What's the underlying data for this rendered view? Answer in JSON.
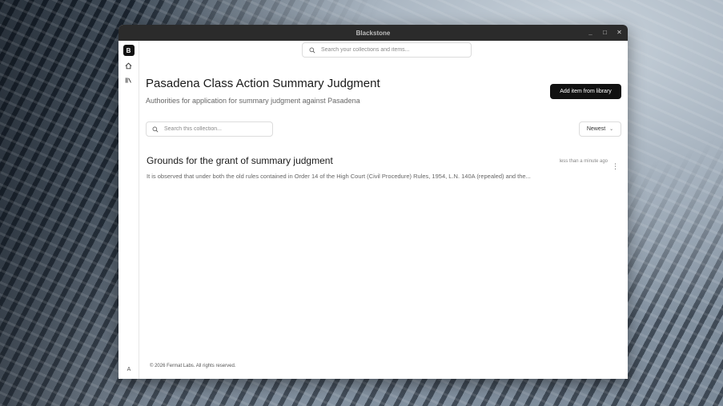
{
  "window": {
    "title": "Blackstone",
    "controls": {
      "minimize": "_",
      "maximize": "□",
      "close": "✕"
    }
  },
  "sidebar": {
    "logo": "B",
    "items": [
      {
        "icon": "home-icon"
      },
      {
        "icon": "library-icon"
      }
    ],
    "avatar": "A"
  },
  "search": {
    "placeholder": "Search your collections and items..."
  },
  "collection": {
    "title": "Pasadena Class Action Summary Judgment",
    "subtitle": "Authorities for application for summary judgment against Pasadena",
    "add_button": "Add item from library",
    "search_placeholder": "Search this collection...",
    "sort": "Newest"
  },
  "items": [
    {
      "title": "Grounds for the grant of summary judgment",
      "time": "less than a minute ago",
      "excerpt": "It is observed that under both the old rules contained in Order 14 of the High Court (Civil Procedure) Rules, 1954, L.N. 140A (repealed) and the..."
    }
  ],
  "footer": {
    "copyright": "© 2026 Fermat Labs. All rights reserved."
  },
  "colors": {
    "titlebar": "#2b2b2b",
    "primary_button": "#111111",
    "background": "#ffffff"
  }
}
